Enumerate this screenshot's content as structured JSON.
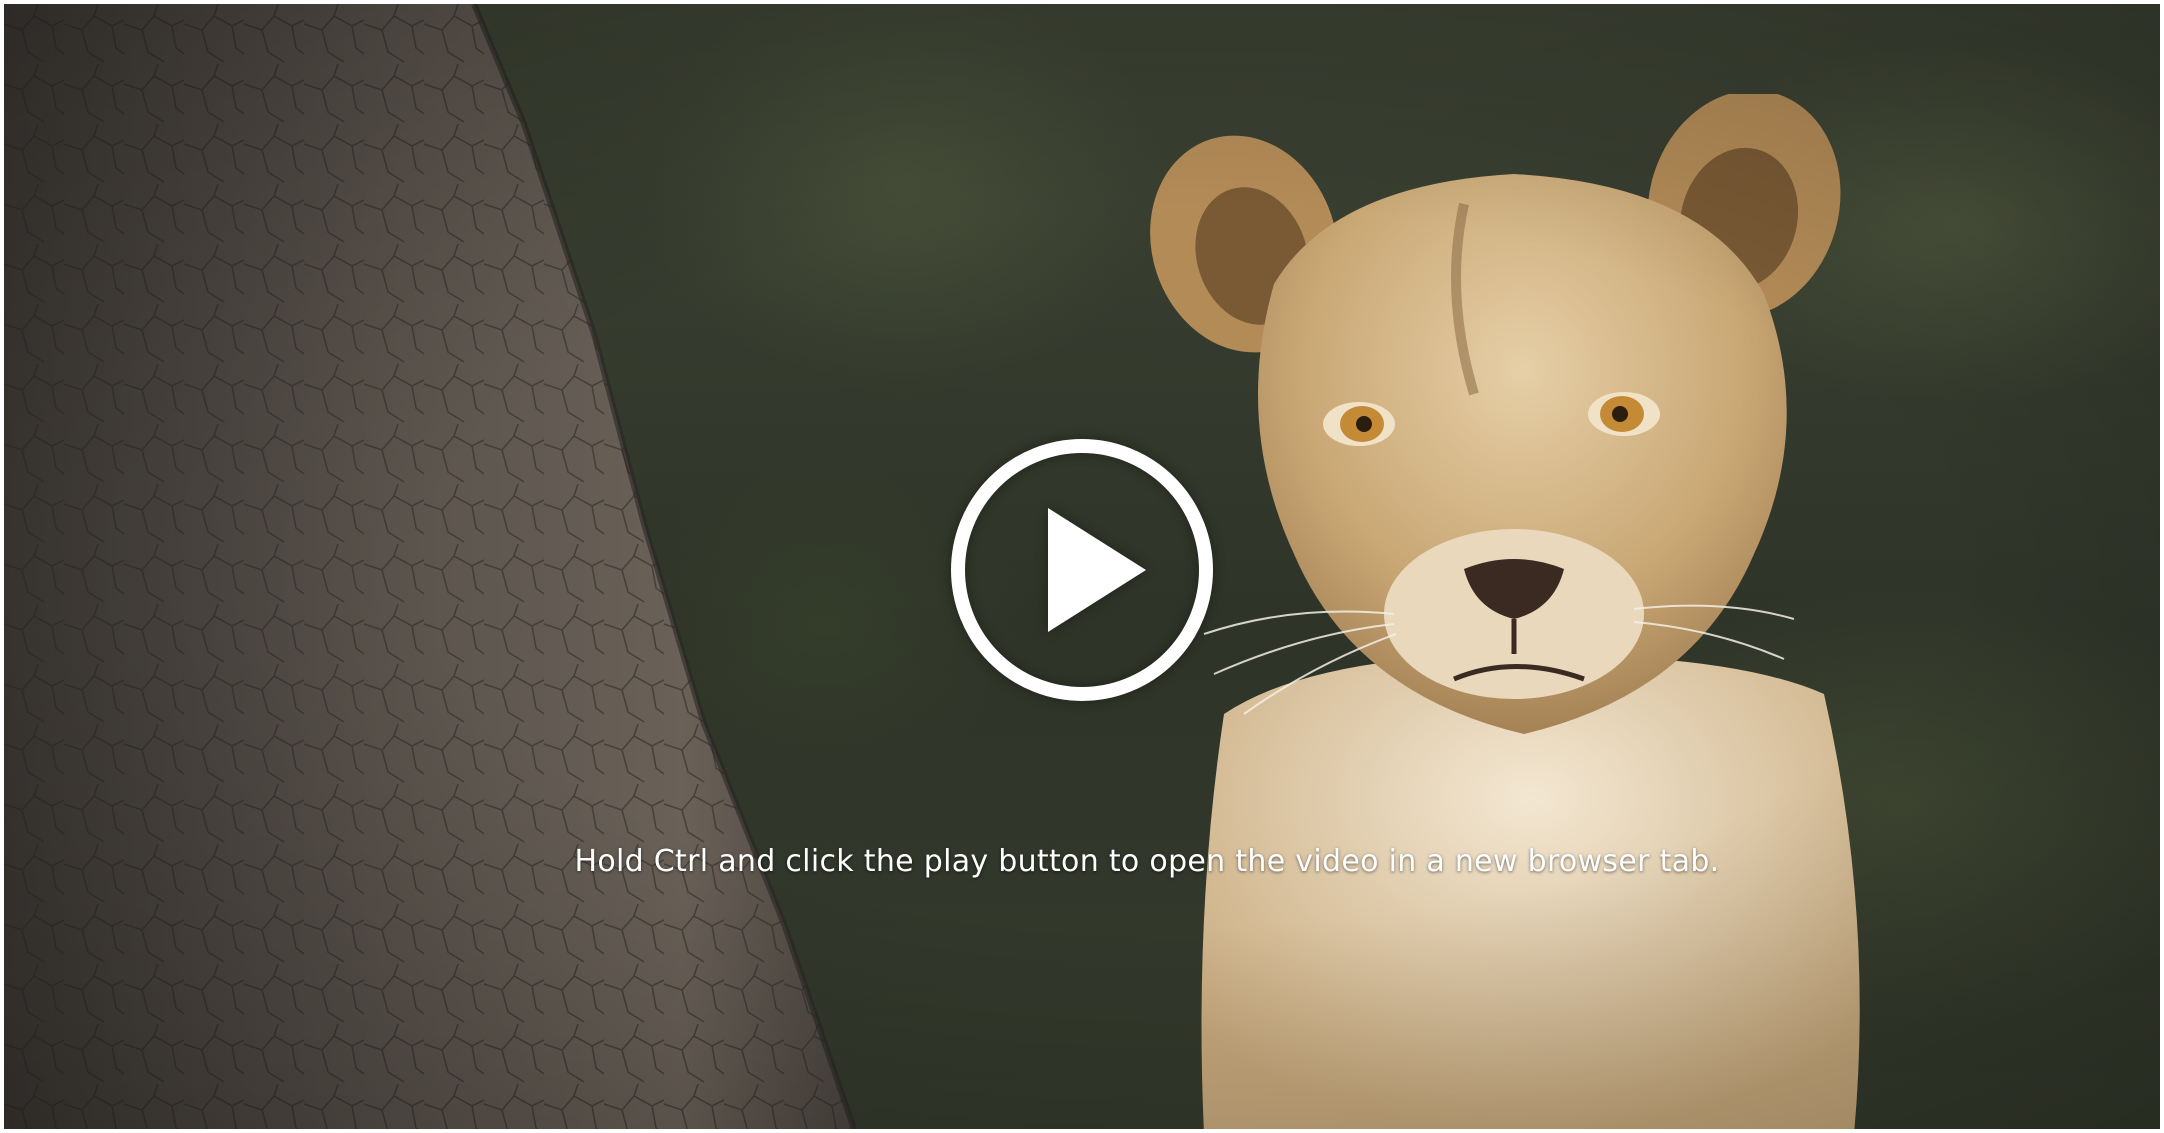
{
  "video": {
    "hint_text": "Hold Ctrl and click the play button to open the video in a new browser tab.",
    "play_icon": "play-circle-icon"
  },
  "colors": {
    "play_icon": "#ffffff",
    "hint_text": "#ffffff",
    "page_border": "#ffffff"
  }
}
